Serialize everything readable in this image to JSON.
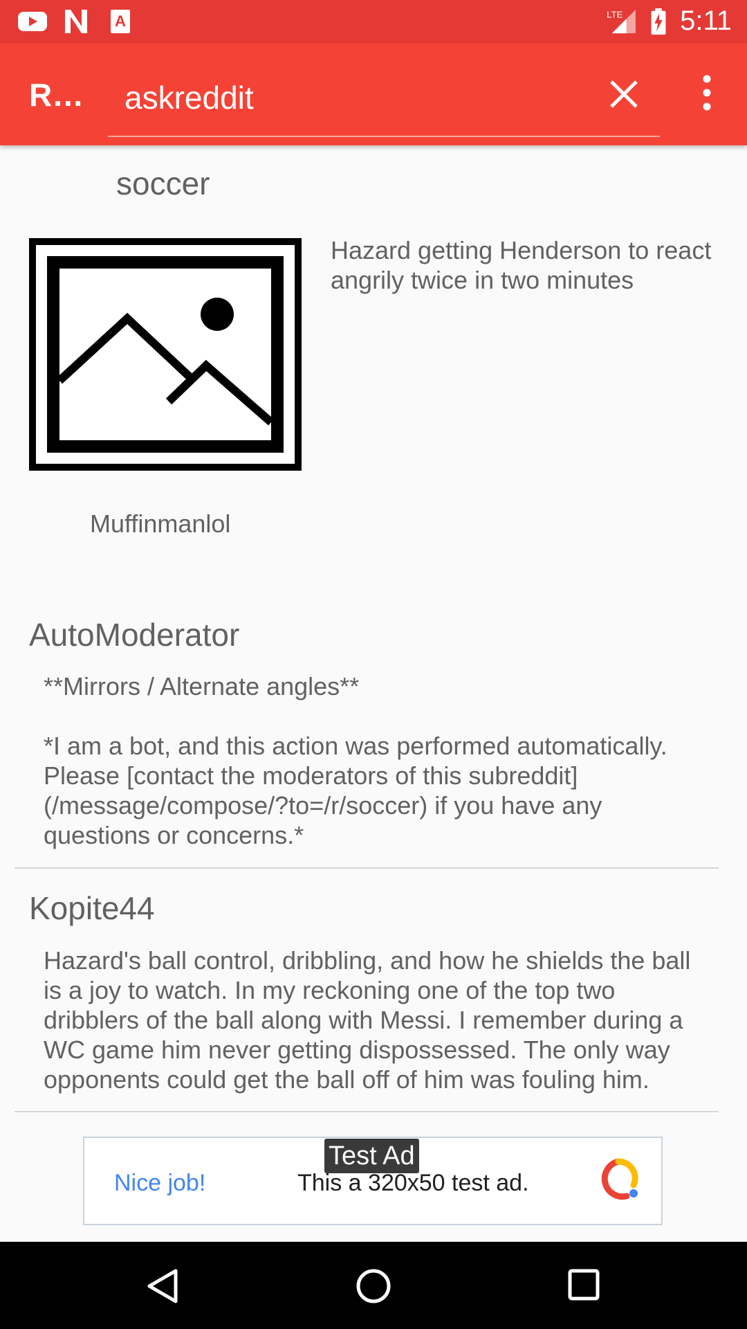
{
  "status_bar": {
    "time": "5:11",
    "icons": [
      "youtube-icon",
      "netflix-icon",
      "accessibility-a-icon",
      "lte-signal-icon",
      "battery-charging-icon"
    ],
    "network_label": "LTE"
  },
  "toolbar": {
    "app_title": "R…",
    "search_value": "askreddit",
    "clear_icon": "close-icon",
    "menu_icon": "more-vert-icon"
  },
  "post": {
    "subreddit": "soccer",
    "title": "Hazard getting Henderson to react angrily twice in two minutes",
    "author": "Muffinmanlol",
    "thumbnail_icon": "image-placeholder-icon"
  },
  "comments": [
    {
      "author": "AutoModerator",
      "body": "**Mirrors / Alternate angles**\n\n*I am a bot, and this action was performed automatically. Please [contact the moderators of this subreddit](/message/compose/?to=/r/soccer) if you have any questions or concerns.*"
    },
    {
      "author": "Kopite44",
      "body": "Hazard's ball control, dribbling, and how he shields the ball is a joy to watch. In my reckoning one of the top two dribblers of the ball along with Messi. I remember during a WC game him never getting dispossessed. The only way opponents could get the ball off of him was fouling him."
    }
  ],
  "ad": {
    "tag": "Test Ad",
    "cta": "Nice job!",
    "text": "This a 320x50 test ad.",
    "logo_icon": "admob-logo-icon"
  },
  "nav_bar": {
    "back_icon": "back-icon",
    "home_icon": "home-icon",
    "recents_icon": "recents-icon"
  },
  "colors": {
    "status_bar": "#e53935",
    "toolbar": "#f44336",
    "text": "#616161",
    "ad_link": "#4285f4"
  }
}
